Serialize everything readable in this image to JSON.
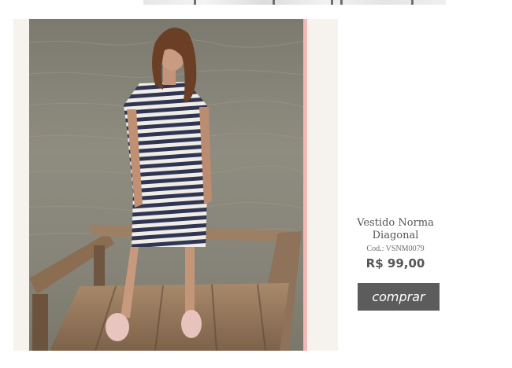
{
  "product": {
    "name": "Vestido Norma Diagonal",
    "code": "Cod.: VSNM0079",
    "price": "R$ 99,00",
    "buy_label": "comprar",
    "image_icon": "product-photo-striped-dress"
  },
  "colors": {
    "button": "#5c5c5c",
    "text": "#555555",
    "frame_background": "#f6f3ef",
    "accent_edge": "#f2b8b5"
  }
}
